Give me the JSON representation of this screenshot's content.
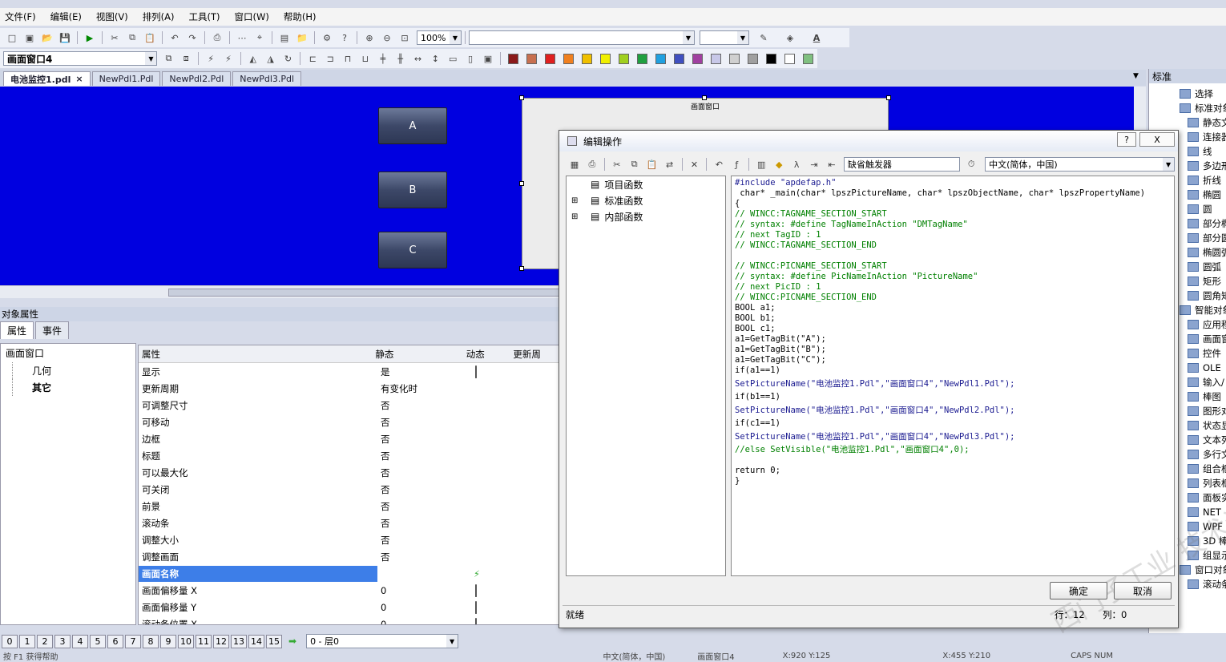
{
  "menubar": [
    "文件(F)",
    "编辑(E)",
    "视图(V)",
    "排列(A)",
    "工具(T)",
    "窗口(W)",
    "帮助(H)"
  ],
  "toolbar": {
    "zoom": "100%",
    "object_combo": "画面窗口4",
    "font_color_label": "A"
  },
  "doc_tabs": [
    {
      "label": "电池监控1.pdl",
      "active": true
    },
    {
      "label": "NewPdl1.Pdl"
    },
    {
      "label": "NewPdl2.Pdl"
    },
    {
      "label": "NewPdl3.Pdl"
    }
  ],
  "doc_tab_close": "×",
  "canvas": {
    "buttons": [
      "A",
      "B",
      "C"
    ],
    "picture_window_title": "画面窗口"
  },
  "props": {
    "panel_title": "对象属性",
    "tabs": [
      "属性",
      "事件"
    ],
    "tree_root": "画面窗口",
    "tree_items": [
      "几何",
      "其它"
    ],
    "columns": [
      "属性",
      "静态",
      "动态",
      "更新周"
    ],
    "rows": [
      {
        "name": "显示",
        "static": "是",
        "dyn": "bulb"
      },
      {
        "name": "更新周期",
        "static": "有变化时",
        "dyn": ""
      },
      {
        "name": "可调整尺寸",
        "static": "否",
        "dyn": ""
      },
      {
        "name": "可移动",
        "static": "否",
        "dyn": ""
      },
      {
        "name": "边框",
        "static": "否",
        "dyn": ""
      },
      {
        "name": "标题",
        "static": "否",
        "dyn": ""
      },
      {
        "name": "可以最大化",
        "static": "否",
        "dyn": ""
      },
      {
        "name": "可关闭",
        "static": "否",
        "dyn": ""
      },
      {
        "name": "前景",
        "static": "否",
        "dyn": ""
      },
      {
        "name": "滚动条",
        "static": "否",
        "dyn": ""
      },
      {
        "name": "调整大小",
        "static": "否",
        "dyn": ""
      },
      {
        "name": "调整画面",
        "static": "否",
        "dyn": ""
      },
      {
        "name": "画面名称",
        "static": "",
        "dyn": "lightning",
        "selected": true
      },
      {
        "name": "画面偏移量  X",
        "static": "0",
        "dyn": "bulb"
      },
      {
        "name": "画面偏移量  Y",
        "static": "0",
        "dyn": "bulb"
      },
      {
        "name": "滚动条位置 X",
        "static": "0",
        "dyn": "bulb"
      }
    ]
  },
  "pagebar": {
    "pages": [
      "0",
      "1",
      "2",
      "3",
      "4",
      "5",
      "6",
      "7",
      "8",
      "9",
      "10",
      "11",
      "12",
      "13",
      "14",
      "15"
    ],
    "layer": "0 - 层0"
  },
  "right_panel": {
    "title": "标准",
    "items": [
      "选择",
      "标准对象",
      "静态文",
      "连接器",
      "线",
      "多边形",
      "折线",
      "椭圆",
      "圆",
      "部分椭",
      "部分圆",
      "椭圆弧",
      "圆弧",
      "矩形",
      "圆角矩",
      "智能对象",
      "应用程",
      "画面窗",
      "控件",
      "OLE",
      "输入/",
      "棒图",
      "图形对",
      "状态显",
      "文本列",
      "多行文",
      "组合框",
      "列表框",
      "面板实",
      "NET",
      "WPF",
      "3D 棒",
      "组显示",
      "窗口对象",
      "滚动条"
    ]
  },
  "dialog": {
    "title": "编辑操作",
    "help": "?",
    "close": "X",
    "trigger": "缺省触发器",
    "language": "中文(简体，中国)",
    "functions": [
      "项目函数",
      "标准函数",
      "内部函数"
    ],
    "code": [
      "#include \"apdefap.h\"",
      " char* _main(char* lpszPictureName, char* lpszObjectName, char* lpszPropertyName)",
      "{",
      "// WINCC:TAGNAME_SECTION_START",
      "// syntax: #define TagNameInAction \"DMTagName\"",
      "// next TagID : 1",
      "// WINCC:TAGNAME_SECTION_END",
      "",
      "// WINCC:PICNAME_SECTION_START",
      "// syntax: #define PicNameInAction \"PictureName\"",
      "// next PicID : 1",
      "// WINCC:PICNAME_SECTION_END",
      "BOOL a1;",
      "BOOL b1;",
      "BOOL c1;",
      "a1=GetTagBit(\"A\");",
      "a1=GetTagBit(\"B\");",
      "a1=GetTagBit(\"C\");",
      "if(a1==1)",
      "SetPictureName(\"电池监控1.Pdl\",\"画面窗口4\",\"NewPdl1.Pdl\");",
      "if(b1==1)",
      "SetPictureName(\"电池监控1.Pdl\",\"画面窗口4\",\"NewPdl2.Pdl\");",
      "if(c1==1)",
      "SetPictureName(\"电池监控1.Pdl\",\"画面窗口4\",\"NewPdl3.Pdl\");",
      "//else SetVisible(\"电池监控1.Pdl\",\"画面窗口4\",0);",
      "",
      "return 0;",
      "}"
    ],
    "ok": "确定",
    "cancel": "取消",
    "status": "就绪",
    "row_label": "行：12",
    "col_label": "列：0"
  },
  "watermark": "西门子工业  技术论坛  support.industry.siemens.com",
  "statusbar": {
    "help": "按 F1 获得帮助",
    "lang": "中文(简体，中国)",
    "object": "画面窗口4",
    "coords1": "X:920 Y:125",
    "coords2": "X:455 Y:210",
    "caps": "CAPS NUM"
  },
  "colors": {
    "canvas": "#0000e0",
    "selection": "#3d7ee8",
    "comment": "#008000",
    "string": "#c00000"
  },
  "swatches": [
    "#8b1a1a",
    "#c87050",
    "#e02020",
    "#f08020",
    "#f0c000",
    "#f0f000",
    "#a0d020",
    "#20a040",
    "#20a0e0",
    "#4050c0",
    "#a040a0",
    "#c8c8e8",
    "#d0d0d0",
    "#a0a0a0",
    "#000000",
    "#ffffff",
    "#80c080"
  ]
}
